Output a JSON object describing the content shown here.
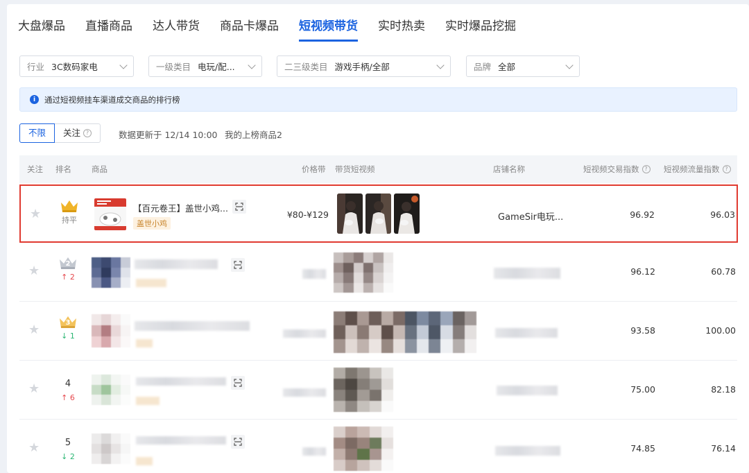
{
  "tabs": [
    "大盘爆品",
    "直播商品",
    "达人带货",
    "商品卡爆品",
    "短视频带货",
    "实时热卖",
    "实时爆品挖掘"
  ],
  "active_tab": 4,
  "filters": [
    {
      "label": "行业",
      "value": "3C数码家电"
    },
    {
      "label": "一级类目",
      "value": "电玩/配..."
    },
    {
      "label": "二三级类目",
      "value": "游戏手柄/全部"
    },
    {
      "label": "品牌",
      "value": "全部"
    }
  ],
  "info_text": "通过短视频挂车渠道成交商品的排行榜",
  "toggle": {
    "all": "不限",
    "follow": "关注"
  },
  "update_text": "数据更新于 12/14 10:00",
  "my_items_text": "我的上榜商品2",
  "table_headers": {
    "follow": "关注",
    "rank": "排名",
    "product": "商品",
    "price": "价格带",
    "videos": "带货短视频",
    "shop": "店铺名称",
    "trade_index": "短视频交易指数",
    "traffic_index": "短视频流量指数"
  },
  "rows": [
    {
      "rank": "1",
      "change": "持平",
      "change_dir": "flat",
      "name": "【百元卷王】盖世小鸡...",
      "tag": "盖世小鸡",
      "price": "¥80-¥129",
      "shop": "GameSir电玩...",
      "trade_index": "96.92",
      "traffic_index": "96.03"
    },
    {
      "rank": "2",
      "change": "↑ 2",
      "change_dir": "up",
      "name": "",
      "tag": "",
      "price": "",
      "shop": "",
      "trade_index": "96.12",
      "traffic_index": "60.78"
    },
    {
      "rank": "3",
      "change": "↓ 1",
      "change_dir": "down",
      "name": "",
      "tag": "",
      "price": "",
      "shop": "",
      "trade_index": "93.58",
      "traffic_index": "100.00"
    },
    {
      "rank": "4",
      "change": "↑ 6",
      "change_dir": "up",
      "name": "",
      "tag": "",
      "price": "",
      "shop": "",
      "trade_index": "75.00",
      "traffic_index": "82.18"
    },
    {
      "rank": "5",
      "change": "↓ 2",
      "change_dir": "down",
      "name": "",
      "tag": "",
      "price": "",
      "shop": "",
      "trade_index": "74.85",
      "traffic_index": "76.14"
    }
  ],
  "colors": {
    "accent": "#1b63e0",
    "highlight_border": "#e03a30",
    "up": "#e5484d",
    "down": "#2bb673",
    "gold": "#f0b429",
    "silver": "#c3c8d0"
  }
}
